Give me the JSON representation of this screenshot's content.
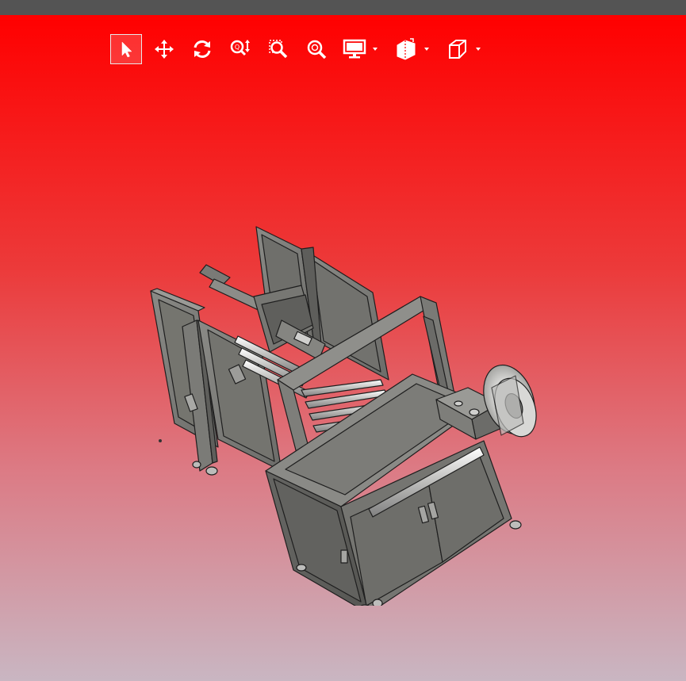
{
  "window": {
    "title_bar_color": "#545454"
  },
  "viewport": {
    "background_top": "#ff0000",
    "background_bottom": "#c9b6c2"
  },
  "toolbar": {
    "tools": [
      {
        "name": "select",
        "icon": "cursor-arrow-icon",
        "active": true
      },
      {
        "name": "pan",
        "icon": "move-arrows-icon",
        "active": false
      },
      {
        "name": "rotate",
        "icon": "rotate-icon",
        "active": false
      },
      {
        "name": "zoom",
        "icon": "zoom-updown-icon",
        "active": false
      },
      {
        "name": "zoom-window",
        "icon": "zoom-window-icon",
        "active": false
      },
      {
        "name": "zoom-fit",
        "icon": "zoom-fit-icon",
        "active": false
      },
      {
        "name": "display",
        "icon": "monitor-icon",
        "has_menu": true
      },
      {
        "name": "section",
        "icon": "section-cut-icon",
        "has_menu": true
      },
      {
        "name": "standard-view",
        "icon": "cube-view-icon",
        "has_menu": true
      }
    ]
  },
  "model": {
    "description_icon": "strapping-machine-3d-model",
    "shade_color": "#7d7d7a"
  }
}
